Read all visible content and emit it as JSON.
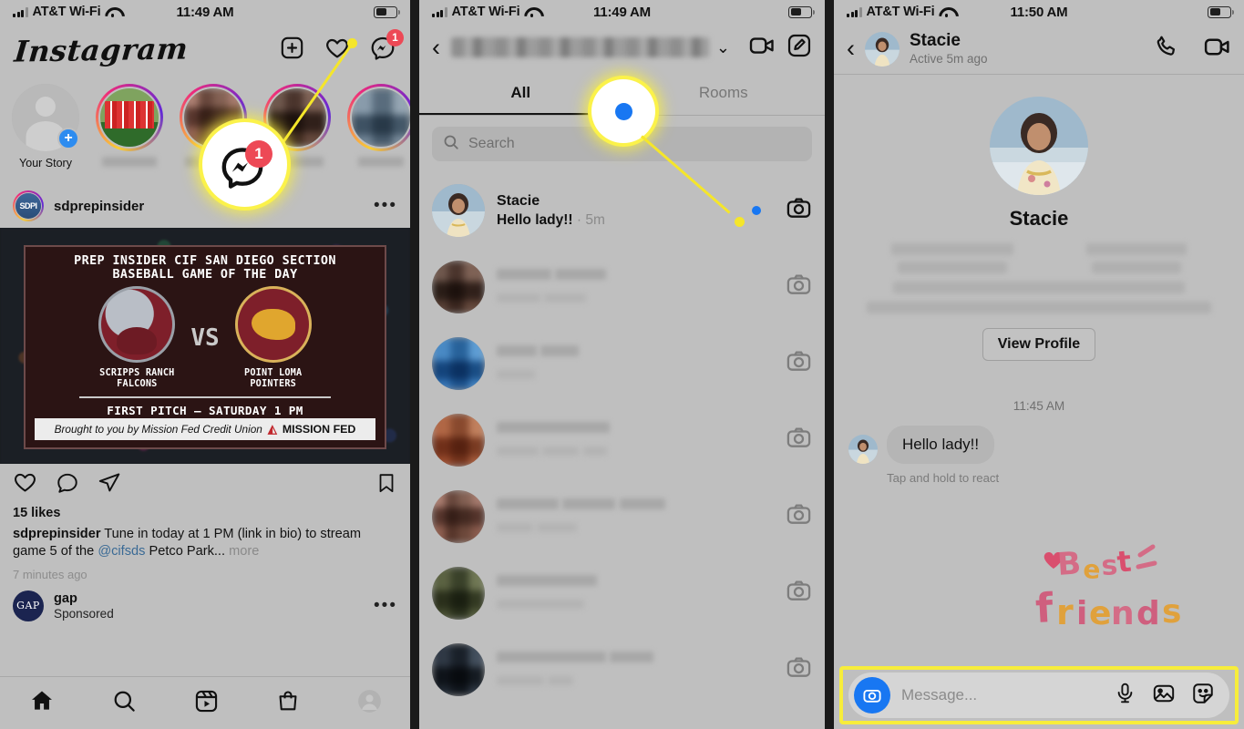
{
  "panel1": {
    "status": {
      "carrier": "AT&T Wi-Fi",
      "time": "11:49 AM"
    },
    "app_logo": "Instagram",
    "header_icons": [
      {
        "name": "add-post-icon",
        "glyph": "+"
      },
      {
        "name": "activity-heart-icon",
        "glyph": "♡"
      },
      {
        "name": "messenger-icon",
        "glyph": "messenger"
      }
    ],
    "messenger_badge": "1",
    "stories": [
      {
        "label": "Your Story",
        "blurred": false
      },
      {
        "label": "",
        "blurred": true
      },
      {
        "label": "",
        "blurred": true
      },
      {
        "label": "",
        "blurred": true
      },
      {
        "label": "",
        "blurred": true
      }
    ],
    "post": {
      "username": "sdprepinsider",
      "avatar_text": "SDPI",
      "more_label": "•••",
      "flyer": {
        "title_line1": "PREP INSIDER CIF SAN DIEGO SECTION",
        "title_line2": "BASEBALL GAME OF THE DAY",
        "team_left_line1": "SCRIPPS RANCH",
        "team_left_line2": "FALCONS",
        "vs": "VS",
        "team_right_line1": "POINT LOMA",
        "team_right_line2": "POINTERS",
        "first_pitch": "FIRST PITCH – SATURDAY 1 PM",
        "sponsor_text": "Brought to you by Mission Fed Credit Union",
        "sponsor_brand": "MISSION FED",
        "sponsor_sub": "CREDIT UNION"
      },
      "likes": "15 likes",
      "caption_user": "sdprepinsider",
      "caption_text": " Tune in today at 1 PM (link in bio) to stream game 5 of the ",
      "caption_mention": "@cifsds",
      "caption_tail": " Petco Park...",
      "caption_more": " more",
      "timeago": "7 minutes ago"
    },
    "sponsored": {
      "avatar_text": "GAP",
      "name": "gap",
      "label": "Sponsored",
      "more_label": "•••"
    },
    "tabbar": [
      {
        "name": "home-icon"
      },
      {
        "name": "search-icon"
      },
      {
        "name": "reels-icon"
      },
      {
        "name": "shop-icon"
      },
      {
        "name": "profile-avatar-icon"
      }
    ]
  },
  "panel2": {
    "status": {
      "carrier": "AT&T Wi-Fi",
      "time": "11:49 AM"
    },
    "header": {
      "back": "‹",
      "username_blurred": true,
      "chevron": "⌄"
    },
    "tabs": [
      {
        "label": "All",
        "active": true
      },
      {
        "label": "Rooms",
        "active": false
      }
    ],
    "search_placeholder": "Search",
    "rows": [
      {
        "name": "Stacie",
        "preview": "Hello lady!!",
        "time": " · 5m",
        "unread": true,
        "blurred": false
      },
      {
        "name": "",
        "preview": "",
        "time": "",
        "unread": false,
        "blurred": true
      },
      {
        "name": "",
        "preview": "",
        "time": "",
        "unread": false,
        "blurred": true
      },
      {
        "name": "",
        "preview": "",
        "time": "",
        "unread": false,
        "blurred": true
      },
      {
        "name": "",
        "preview": "",
        "time": "",
        "unread": false,
        "blurred": true
      },
      {
        "name": "",
        "preview": "",
        "time": "",
        "unread": false,
        "blurred": true
      },
      {
        "name": "",
        "preview": "",
        "time": "",
        "unread": false,
        "blurred": true
      }
    ]
  },
  "panel3": {
    "status": {
      "carrier": "AT&T Wi-Fi",
      "time": "11:50 AM"
    },
    "header": {
      "back": "‹",
      "name": "Stacie",
      "subtitle": "Active 5m ago"
    },
    "profile": {
      "name": "Stacie",
      "view_profile": "View Profile"
    },
    "timestamp": "11:45 AM",
    "message": {
      "text": "Hello lady!!",
      "hint": "Tap and hold to react"
    },
    "sticker": {
      "line1": "Best",
      "line2": "friends"
    },
    "composer": {
      "placeholder": "Message...",
      "icons": [
        "camera-icon",
        "microphone-icon",
        "photo-library-icon",
        "sticker-icon"
      ]
    }
  },
  "colors": {
    "highlight": "#f7ed3b",
    "badge_red": "#ed4956",
    "messenger_blue": "#1877f2",
    "link_blue": "#3a6a95"
  }
}
